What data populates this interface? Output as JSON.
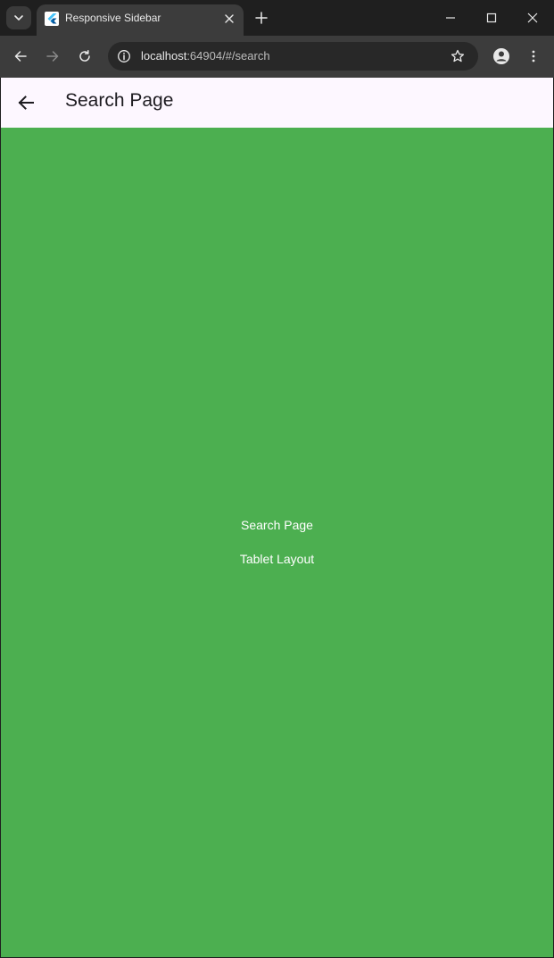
{
  "browser": {
    "tab_title": "Responsive Sidebar",
    "url_host": "localhost",
    "url_rest": ":64904/#/search"
  },
  "app": {
    "appbar_title": "Search Page",
    "body_line_1": "Search Page",
    "body_line_2": "Tablet Layout"
  },
  "colors": {
    "page_background": "#4caf50",
    "appbar_background": "#fdf7ff",
    "browser_chrome": "#1f1f1f",
    "toolbar": "#3c3c3c"
  },
  "icons": {
    "tab_search": "chevron-down-icon",
    "favicon": "flutter-icon",
    "tab_close": "close-icon",
    "new_tab": "plus-icon",
    "minimize": "minimize-icon",
    "maximize": "maximize-icon",
    "close_window": "close-icon",
    "back": "arrow-left-icon",
    "forward": "arrow-right-icon",
    "reload": "reload-icon",
    "site_info": "info-icon",
    "bookmark": "star-icon",
    "profile": "person-icon",
    "menu": "more-vert-icon",
    "appbar_back": "arrow-back-icon"
  }
}
